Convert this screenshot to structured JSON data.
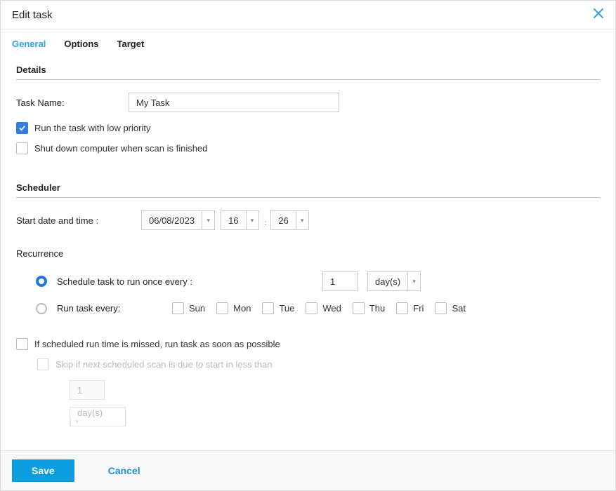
{
  "header": {
    "title": "Edit task"
  },
  "tabs": {
    "general": "General",
    "options": "Options",
    "target": "Target",
    "active": "general"
  },
  "details": {
    "section": "Details",
    "task_name_label": "Task Name:",
    "task_name_value": "My Task",
    "low_priority_label": "Run the task with low priority",
    "low_priority_checked": true,
    "shutdown_label": "Shut down computer when scan is finished",
    "shutdown_checked": false
  },
  "scheduler": {
    "section": "Scheduler",
    "start_label": "Start date and time :",
    "date": "06/08/2023",
    "hour": "16",
    "minute": "26",
    "recurrence_label": "Recurrence",
    "mode": "every_n",
    "every_n_label": "Schedule task to run once every :",
    "every_n_value": "1",
    "every_n_unit": "day(s)",
    "weekly_label": "Run task every:",
    "days": {
      "sun": "Sun",
      "mon": "Mon",
      "tue": "Tue",
      "wed": "Wed",
      "thu": "Thu",
      "fri": "Fri",
      "sat": "Sat"
    },
    "missed_label": "If scheduled run time is missed, run task as soon as possible",
    "missed_checked": false,
    "skip_label": "Skip if next scheduled scan is due to start in less than",
    "skip_value": "1",
    "skip_unit": "day(s)"
  },
  "footer": {
    "save": "Save",
    "cancel": "Cancel"
  }
}
